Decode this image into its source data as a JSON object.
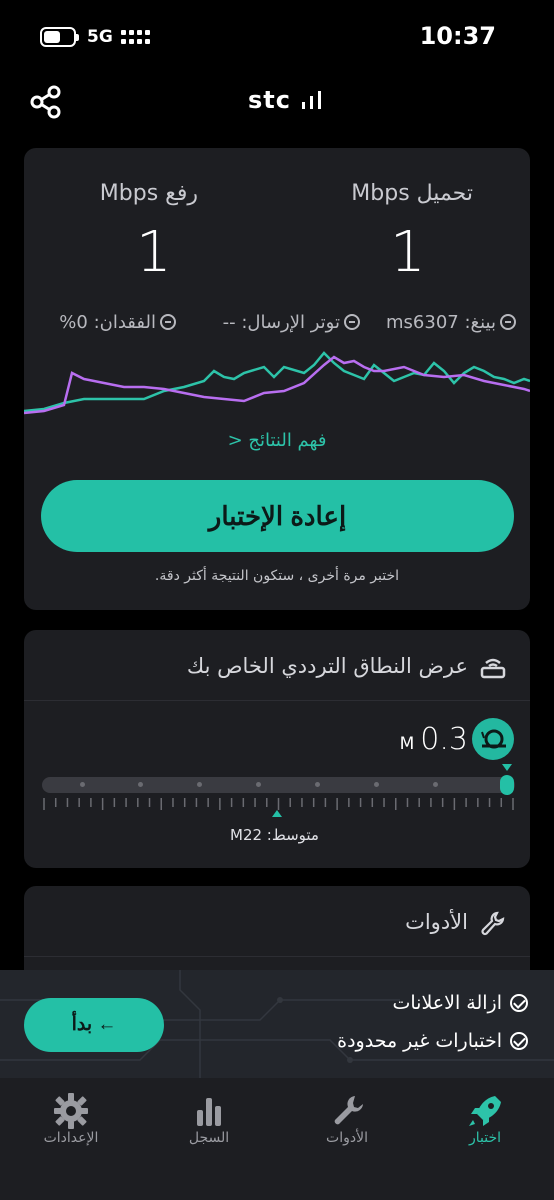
{
  "status_bar": {
    "network": "5G",
    "time": "10:37"
  },
  "header": {
    "logo_text": "stc",
    "logo_icon": "signal-bars-icon",
    "share_icon": "share-icon"
  },
  "results": {
    "download_label": "تحميل Mbps",
    "download_value": "1",
    "upload_label": "رفع Mbps",
    "upload_value": "1",
    "ping_text": "بينغ: ms6307",
    "jitter_text": "توتر الإرسال: --",
    "loss_text": "الفقدان: 0%",
    "understand_link": "فهم النتائج <",
    "retest_button": "إعادة الإختبار",
    "hint": "اختبر مرة أخرى ، ستكون النتيجة أكثر دقة.",
    "download_color": "#2dc3a9",
    "upload_color": "#b86ef0"
  },
  "bandwidth": {
    "title": "عرض النطاق الترددي الخاص بك",
    "value": "0.3",
    "unit": "M",
    "speed_icon": "snail-icon",
    "level_fraction": 1.0,
    "average_fraction": 0.5,
    "average_label": "متوسط: M22"
  },
  "tools": {
    "title": "الأدوات"
  },
  "promo": {
    "items": [
      "ازالة الاعلانات",
      "اختبارات غير محدودة"
    ],
    "start_button": "بدأ ←"
  },
  "tabs": [
    {
      "label": "اختبار",
      "icon": "rocket-icon",
      "active": true
    },
    {
      "label": "الأدوات",
      "icon": "wrench-icon",
      "active": false
    },
    {
      "label": "السجل",
      "icon": "bar-chart-icon",
      "active": false
    },
    {
      "label": "الإعدادات",
      "icon": "gear-icon",
      "active": false
    }
  ]
}
